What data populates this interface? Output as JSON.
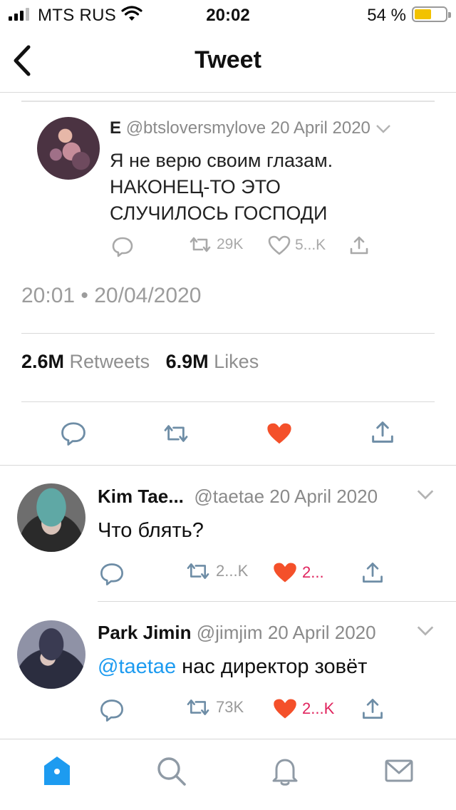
{
  "status_bar": {
    "carrier": "MTS RUS",
    "time": "20:02",
    "battery_percent": "54 %",
    "battery_level": 0.54,
    "battery_color": "#f2c200"
  },
  "nav": {
    "title": "Tweet",
    "back_icon": "chevron-left-icon"
  },
  "quoted_tweet": {
    "name": "E",
    "handle": "@btsloversmylove",
    "date": "20 April 2020",
    "text_line1": "Я не верю своим глазам.",
    "text_line2": "НАКОНЕЦ-ТО ЭТО",
    "text_line3": "СЛУЧИЛОСЬ ГОСПОДИ",
    "retweets": "29K",
    "likes": "5...K"
  },
  "tweet": {
    "timestamp": "20:01 • 20/04/2020",
    "retweet_count": "2.6M",
    "retweet_label": "Retweets",
    "like_count": "6.9M",
    "like_label": "Likes",
    "liked": true
  },
  "replies": [
    {
      "name": "Kim Tae...",
      "handle": "@taetae",
      "date": "20 April 2020",
      "text": "Что блять?",
      "retweets": "2...K",
      "likes": "2..."
    },
    {
      "name": "Park Jimin",
      "handle": "@jimjim",
      "date": "20 April 2020",
      "mention": "@taetae",
      "text": "нас директор зовёт",
      "retweets": "73K",
      "likes": "2...K"
    }
  ],
  "colors": {
    "accent": "#1d9bf0",
    "like": "#f4502a",
    "like_text": "#e0245e"
  },
  "tab_bar": [
    "home-icon",
    "search-icon",
    "notifications-icon",
    "messages-icon"
  ]
}
